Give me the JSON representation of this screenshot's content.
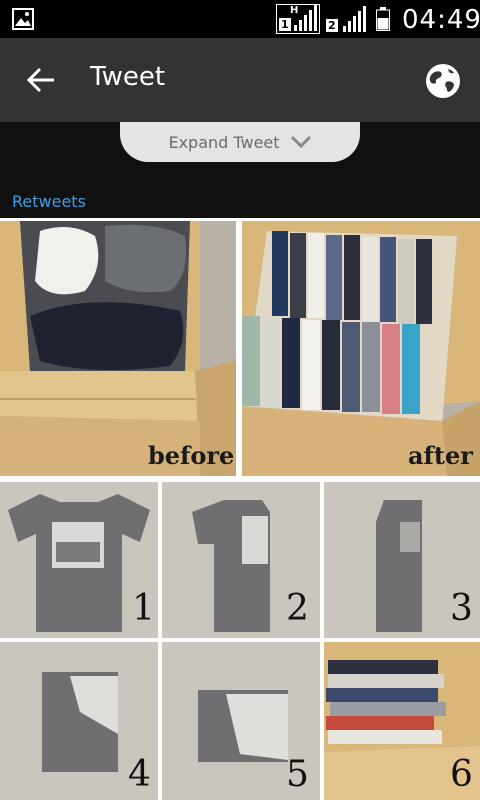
{
  "status_bar": {
    "time": "04:49",
    "sim1_label": "1",
    "sim1_network": "H",
    "sim2_label": "2"
  },
  "app_bar": {
    "title": "Tweet"
  },
  "expand": {
    "label": "Expand Tweet"
  },
  "retweets_label": "Retweets",
  "image": {
    "before_label": "before",
    "after_label": "after",
    "steps": [
      "1",
      "2",
      "3",
      "4",
      "5",
      "6"
    ]
  },
  "colors": {
    "status_bar": "#000000",
    "app_bar": "#333333",
    "link": "#3d9ee0",
    "expand_tab": "#e4e4e4"
  }
}
